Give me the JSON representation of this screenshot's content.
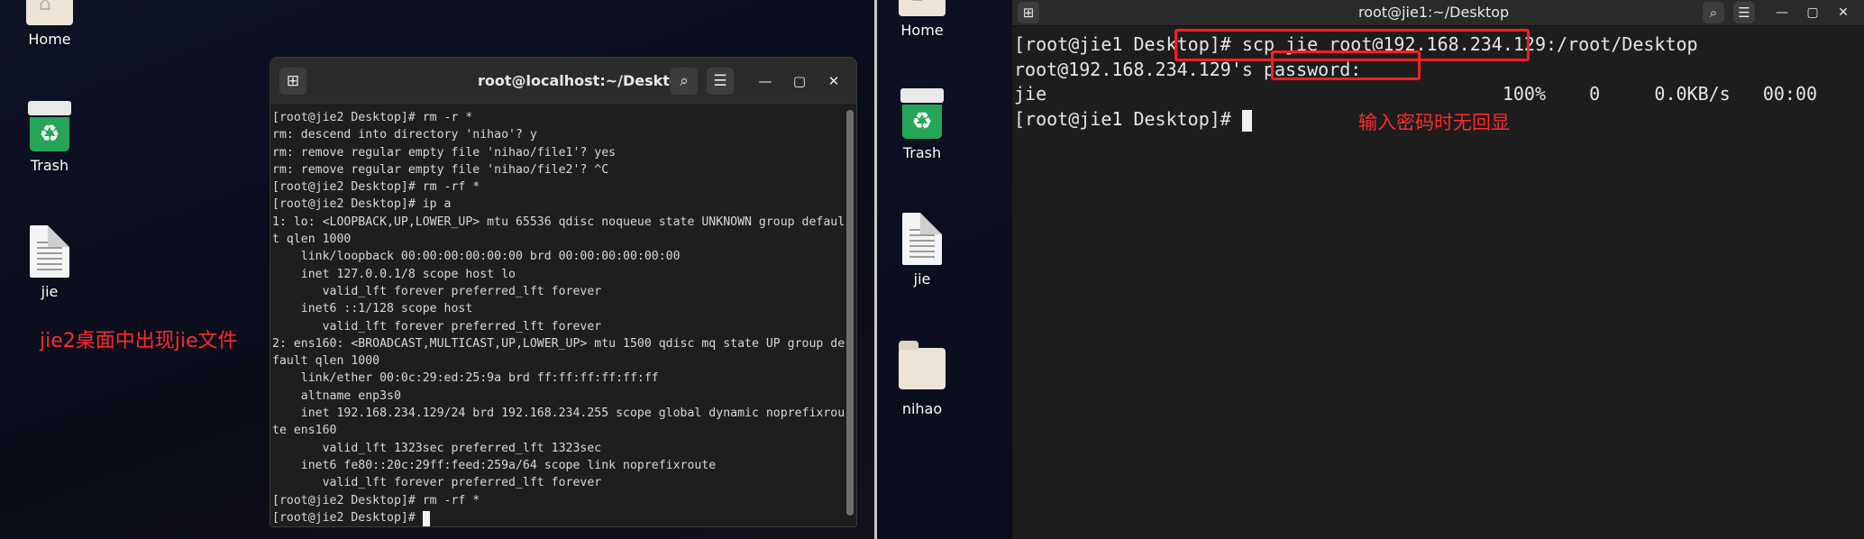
{
  "left_desktop": {
    "icons": [
      {
        "label": "Home",
        "icon": "home-folder-icon"
      },
      {
        "label": "Trash",
        "icon": "trash-icon"
      },
      {
        "label": "jie",
        "icon": "text-file-icon"
      }
    ],
    "annotation": "jie2桌面中出现jie文件"
  },
  "left_terminal": {
    "title": "root@localhost:~/Desktop",
    "lines": [
      "[root@jie2 Desktop]# rm -r *",
      "rm: descend into directory 'nihao'? y",
      "rm: remove regular empty file 'nihao/file1'? yes",
      "rm: remove regular empty file 'nihao/file2'? ^C",
      "[root@jie2 Desktop]# rm -rf *",
      "[root@jie2 Desktop]# ip a",
      "1: lo: <LOOPBACK,UP,LOWER_UP> mtu 65536 qdisc noqueue state UNKNOWN group defaul",
      "t qlen 1000",
      "    link/loopback 00:00:00:00:00:00 brd 00:00:00:00:00:00",
      "    inet 127.0.0.1/8 scope host lo",
      "       valid_lft forever preferred_lft forever",
      "    inet6 ::1/128 scope host",
      "       valid_lft forever preferred_lft forever",
      "2: ens160: <BROADCAST,MULTICAST,UP,LOWER_UP> mtu 1500 qdisc mq state UP group de",
      "fault qlen 1000",
      "    link/ether 00:0c:29:ed:25:9a brd ff:ff:ff:ff:ff:ff",
      "    altname enp3s0",
      "    inet 192.168.234.129/24 brd 192.168.234.255 scope global dynamic noprefixrou",
      "te ens160",
      "       valid_lft 1323sec preferred_lft 1323sec",
      "    inet6 fe80::20c:29ff:feed:259a/64 scope link noprefixroute",
      "       valid_lft forever preferred_lft forever",
      "[root@jie2 Desktop]# rm -rf *",
      "[root@jie2 Desktop]# "
    ]
  },
  "right_desktop": {
    "icons": [
      {
        "label": "Home",
        "icon": "home-folder-icon"
      },
      {
        "label": "Trash",
        "icon": "trash-icon"
      },
      {
        "label": "jie",
        "icon": "text-file-icon"
      },
      {
        "label": "nihao",
        "icon": "folder-icon"
      }
    ]
  },
  "right_terminal": {
    "title": "root@jie1:~/Desktop",
    "lines": [
      "[root@jie1 Desktop]# scp jie root@192.168.234.129:/root/Desktop",
      "root@192.168.234.129's password:",
      "jie                                          100%    0     0.0KB/s   00:00",
      "[root@jie1 Desktop]# "
    ],
    "annotation": "输入密码时无回显"
  },
  "colors": {
    "annotation": "#ff2a2a",
    "terminal_bg": "#1e1e1e",
    "terminal_text": "#d8d8d8"
  }
}
